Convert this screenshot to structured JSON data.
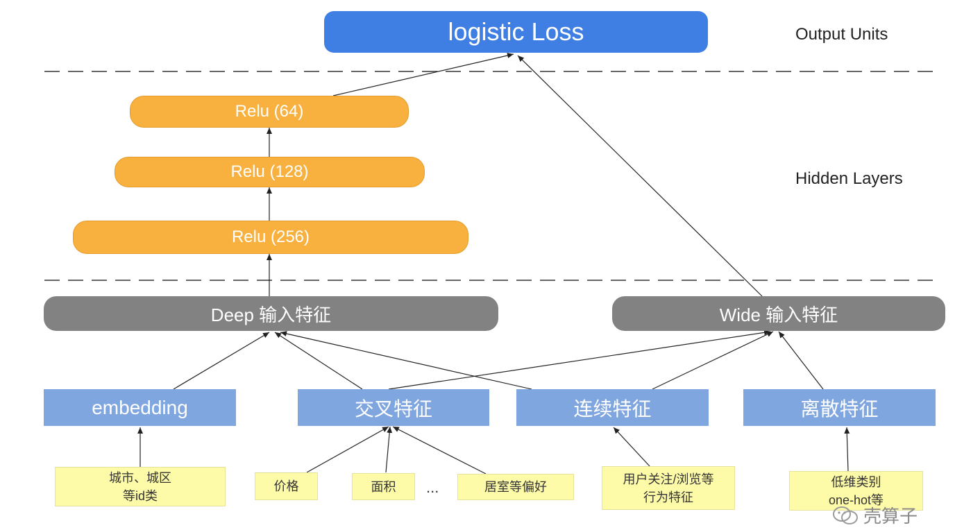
{
  "output": {
    "label": "logistic Loss"
  },
  "side_labels": {
    "output_units": "Output Units",
    "hidden_layers": "Hidden Layers"
  },
  "hidden": {
    "relu64": "Relu (64)",
    "relu128": "Relu (128)",
    "relu256": "Relu (256)"
  },
  "inputs": {
    "deep": "Deep 输入特征",
    "wide": "Wide 输入特征"
  },
  "features": {
    "embedding": "embedding",
    "cross": "交叉特征",
    "continuous": "连续特征",
    "discrete": "离散特征"
  },
  "sources": {
    "city_line1": "城市、城区",
    "city_line2": "等id类",
    "price": "价格",
    "area": "面积",
    "ellipsis": "...",
    "room": "居室等偏好",
    "user_line1": "用户关注/浏览等",
    "user_line2": "行为特征",
    "lowdim_line1": "低维类别",
    "lowdim_line2": "one-hot等"
  },
  "watermark": {
    "text": "壳算子"
  },
  "colors": {
    "output": "#3f7fe3",
    "relu": "#f8b13f",
    "input": "#828282",
    "feature": "#80a6e0",
    "source": "#fdfaa8"
  }
}
